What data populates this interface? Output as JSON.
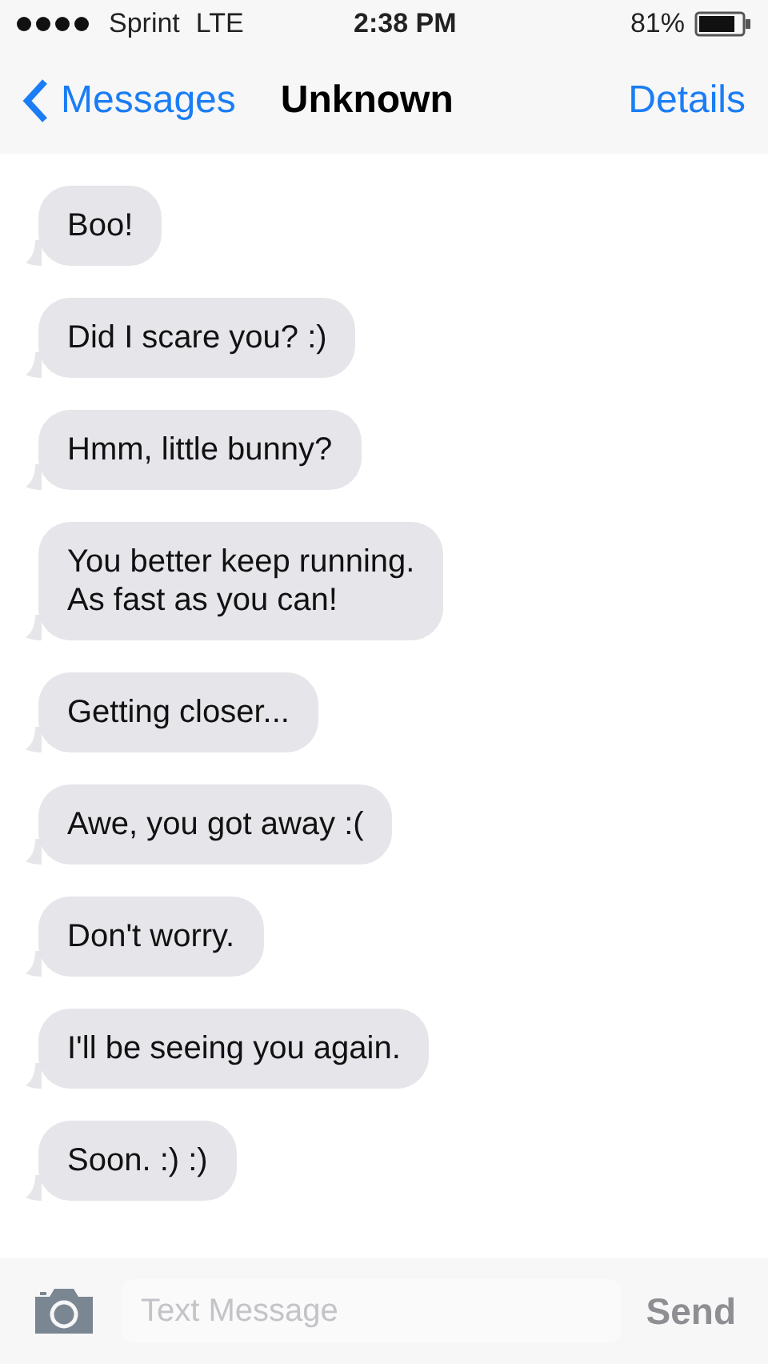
{
  "status_bar": {
    "carrier": "Sprint",
    "network": "LTE",
    "time": "2:38 PM",
    "battery": "81%"
  },
  "nav": {
    "back": "Messages",
    "title": "Unknown",
    "action": "Details"
  },
  "messages": [
    {
      "text": "Boo!"
    },
    {
      "text": "Did I scare you? :)"
    },
    {
      "text": "Hmm, little bunny?"
    },
    {
      "text": "You better keep running.\nAs fast as you can!"
    },
    {
      "text": "Getting closer..."
    },
    {
      "text": "Awe, you got away :("
    },
    {
      "text": "Don't worry."
    },
    {
      "text": "I'll be seeing you again."
    },
    {
      "text": "Soon. :) :)"
    }
  ],
  "composer": {
    "placeholder": "Text Message",
    "send": "Send"
  }
}
